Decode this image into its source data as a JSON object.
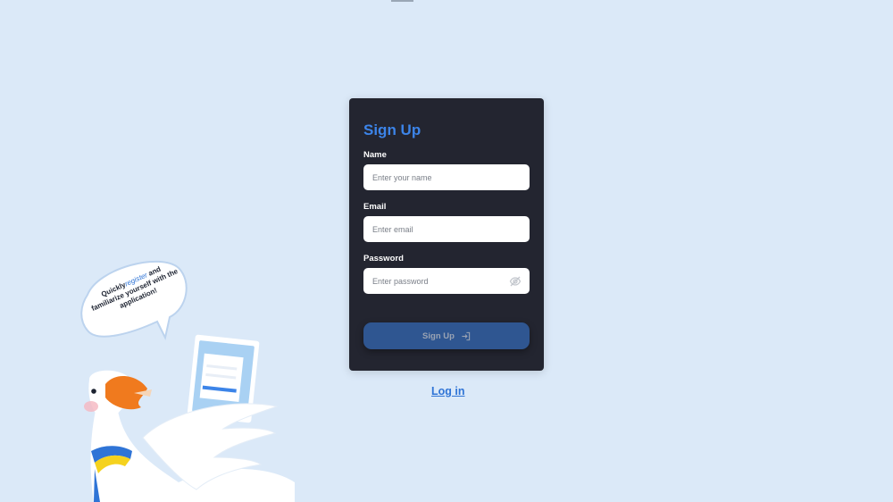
{
  "form": {
    "title": "Sign Up",
    "fields": [
      {
        "label": "Name",
        "placeholder": "Enter your name",
        "value": ""
      },
      {
        "label": "Email",
        "placeholder": "Enter email",
        "value": ""
      },
      {
        "label": "Password",
        "placeholder": "Enter password",
        "value": ""
      }
    ],
    "submit_label": "Sign Up"
  },
  "login_link": "Log in",
  "mascot": {
    "bubble_prefix": "Quickly",
    "bubble_accent": "register",
    "bubble_suffix": "and familiarize yourself with the application!"
  },
  "colors": {
    "background": "#dbe9f8",
    "card": "#232530",
    "accent": "#3c84e8",
    "submit": "#2f5691"
  },
  "icons": {
    "password_toggle": "eye-slash-icon",
    "submit": "login-arrow-icon"
  }
}
